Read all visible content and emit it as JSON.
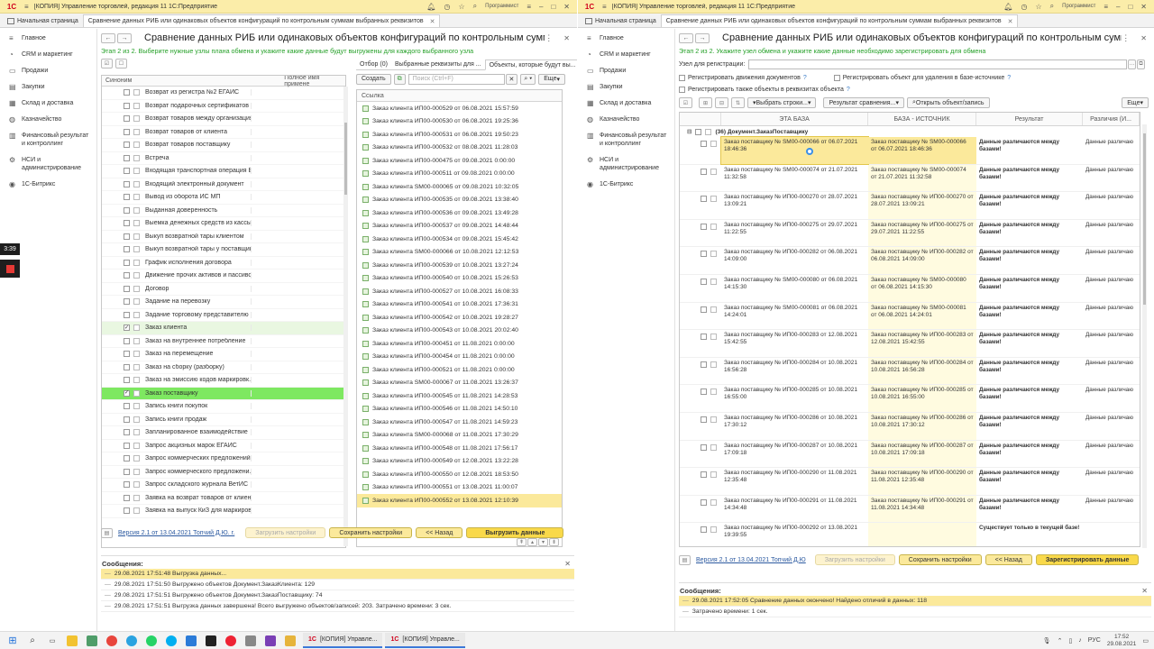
{
  "app": {
    "title": "[КОПИЯ] Управление торговлей, редакция 11  1С:Предприятие",
    "user": "Программист",
    "logo": "1С"
  },
  "tabs": {
    "home": "Начальная страница",
    "active": "Сравнение данных РИБ или одинаковых объектов конфигураций по контрольным суммам выбранных реквизитов"
  },
  "sidebar": [
    {
      "icon": "menu-icon",
      "label": "Главное"
    },
    {
      "icon": "crm-icon",
      "label": "CRM и маркетинг"
    },
    {
      "icon": "sales-icon",
      "label": "Продажи"
    },
    {
      "icon": "purchases-icon",
      "label": "Закупки"
    },
    {
      "icon": "warehouse-icon",
      "label": "Склад и доставка"
    },
    {
      "icon": "treasury-icon",
      "label": "Казначейство"
    },
    {
      "icon": "finance-icon",
      "label": "Финансовый результат и контроллинг"
    },
    {
      "icon": "nsi-icon",
      "label": "НСИ и администрирование"
    },
    {
      "icon": "bitrix-icon",
      "label": "1С-Битрикс"
    }
  ],
  "left": {
    "form_title": "Сравнение данных РИБ или одинаковых объектов конфигураций по контрольным суммам выбр...",
    "stage": "Этап 2 из 2. Выберите нужные узлы плана обмена и укажите какие данные будут выгружены для каждого выбранного узла",
    "col_synonym": "Синоним",
    "col_fullname": "Полное имя примене",
    "objects": [
      {
        "name": "Возврат из регистра №2 ЕГАИС",
        "checked": false,
        "state": ""
      },
      {
        "name": "Возврат подарочных сертификатов",
        "checked": false,
        "state": ""
      },
      {
        "name": "Возврат товаров между организациями",
        "checked": false,
        "state": ""
      },
      {
        "name": "Возврат товаров от клиента",
        "checked": false,
        "state": ""
      },
      {
        "name": "Возврат товаров поставщику",
        "checked": false,
        "state": ""
      },
      {
        "name": "Встреча",
        "checked": false,
        "state": ""
      },
      {
        "name": "Входящая транспортная операция В...",
        "checked": false,
        "state": ""
      },
      {
        "name": "Входящий электронный документ",
        "checked": false,
        "state": ""
      },
      {
        "name": "Вывод из оборота ИС МП",
        "checked": false,
        "state": ""
      },
      {
        "name": "Выданная доверенность",
        "checked": false,
        "state": ""
      },
      {
        "name": "Выемка денежных средств из кассы ...",
        "checked": false,
        "state": ""
      },
      {
        "name": "Выкуп возвратной тары клиентом",
        "checked": false,
        "state": ""
      },
      {
        "name": "Выкуп возвратной тары у поставщика",
        "checked": false,
        "state": ""
      },
      {
        "name": "График исполнения договора",
        "checked": false,
        "state": ""
      },
      {
        "name": "Движение прочих активов и пассивов",
        "checked": false,
        "state": ""
      },
      {
        "name": "Договор",
        "checked": false,
        "state": ""
      },
      {
        "name": "Задание на перевозку",
        "checked": false,
        "state": ""
      },
      {
        "name": "Задание торговому представителю",
        "checked": false,
        "state": ""
      },
      {
        "name": "Заказ клиента",
        "checked": true,
        "state": "sel"
      },
      {
        "name": "Заказ на внутреннее потребление",
        "checked": false,
        "state": ""
      },
      {
        "name": "Заказ на перемещение",
        "checked": false,
        "state": ""
      },
      {
        "name": "Заказ на сборку (разборку)",
        "checked": false,
        "state": ""
      },
      {
        "name": "Заказ на эмиссию кодов маркировк...",
        "checked": false,
        "state": ""
      },
      {
        "name": "Заказ поставщику",
        "checked": true,
        "state": "hl"
      },
      {
        "name": "Запись книги покупок",
        "checked": false,
        "state": ""
      },
      {
        "name": "Запись книги продаж",
        "checked": false,
        "state": ""
      },
      {
        "name": "Запланированное взаимодействие",
        "checked": false,
        "state": ""
      },
      {
        "name": "Запрос акцизных марок ЕГАИС",
        "checked": false,
        "state": ""
      },
      {
        "name": "Запрос коммерческих предложений ...",
        "checked": false,
        "state": ""
      },
      {
        "name": "Запрос коммерческого предложени...",
        "checked": false,
        "state": ""
      },
      {
        "name": "Запрос складского журнала ВетИС",
        "checked": false,
        "state": ""
      },
      {
        "name": "Заявка на возврат товаров от клиента",
        "checked": false,
        "state": ""
      },
      {
        "name": "Заявка на выпуск КиЗ для маркировки",
        "checked": false,
        "state": ""
      }
    ],
    "rp_tabs": [
      "Отбор (0)",
      "Выбранные реквизиты для ...",
      "Объекты, которые будут вы..."
    ],
    "create_btn": "Создать",
    "search_placeholder": "Поиск (Ctrl+F)",
    "more_btn": "Еще",
    "list_header": "Ссылка",
    "refs": [
      "Заказ клиента ИП00-000529 от 06.08.2021 15:57:59",
      "Заказ клиента ИП00-000530 от 06.08.2021 19:25:36",
      "Заказ клиента ИП00-000531 от 06.08.2021 19:50:23",
      "Заказ клиента ИП00-000532 от 08.08.2021 11:28:03",
      "Заказ клиента ИП00-000475 от 09.08.2021 0:00:00",
      "Заказ клиента ИП00-000511 от 09.08.2021 0:00:00",
      "Заказ клиента SM00-000065 от 09.08.2021 10:32:05",
      "Заказ клиента ИП00-000535 от 09.08.2021 13:38:40",
      "Заказ клиента ИП00-000536 от 09.08.2021 13:49:28",
      "Заказ клиента ИП00-000537 от 09.08.2021 14:48:44",
      "Заказ клиента ИП00-000534 от 09.08.2021 15:45:42",
      "Заказ клиента SM00-000066 от 10.08.2021 12:12:53",
      "Заказ клиента ИП00-000539 от 10.08.2021 13:27:24",
      "Заказ клиента ИП00-000540 от 10.08.2021 15:26:53",
      "Заказ клиента ИП00-000527 от 10.08.2021 16:08:33",
      "Заказ клиента ИП00-000541 от 10.08.2021 17:36:31",
      "Заказ клиента ИП00-000542 от 10.08.2021 19:28:27",
      "Заказ клиента ИП00-000543 от 10.08.2021 20:02:40",
      "Заказ клиента ИП00-000451 от 11.08.2021 0:00:00",
      "Заказ клиента ИП00-000454 от 11.08.2021 0:00:00",
      "Заказ клиента ИП00-000521 от 11.08.2021 0:00:00",
      "Заказ клиента SM00-000067 от 11.08.2021 13:26:37",
      "Заказ клиента ИП00-000545 от 11.08.2021 14:28:53",
      "Заказ клиента ИП00-000546 от 11.08.2021 14:50:10",
      "Заказ клиента ИП00-000547 от 11.08.2021 14:59:23",
      "Заказ клиента SM00-000068 от 11.08.2021 17:30:29",
      "Заказ клиента ИП00-000548 от 11.08.2021 17:56:17",
      "Заказ клиента ИП00-000549 от 12.08.2021 13:22:28",
      "Заказ клиента ИП00-000550 от 12.08.2021 18:53:50",
      "Заказ клиента ИП00-000551 от 13.08.2021 11:00:07",
      "Заказ клиента ИП00-000552 от 13.08.2021 12:10:39"
    ],
    "version_link": "Версия 2.1  от 13.04.2021 Топчий Д.Ю. г.",
    "load_settings": "Загрузить настройки",
    "save_settings": "Сохранить настройки",
    "back_btn": "<< Назад",
    "primary_btn": "Выгрузить данные",
    "messages_title": "Сообщения:",
    "messages": [
      "29.08.2021 17:51:48 Выгрузка данных...",
      "29.08.2021 17:51:50 Выгружено объектов Документ.ЗаказКлиента: 129",
      "29.08.2021 17:51:51 Выгружено объектов Документ.ЗаказПоставщику: 74",
      "29.08.2021 17:51:51 Выгрузка данных завершена! Всего выгружено объектов/записей: 203. Затрачено времени: 3 сек."
    ]
  },
  "right": {
    "form_title": "Сравнение данных РИБ или одинаковых объектов конфигураций по контрольным суммам выбр...",
    "stage": "Этап 2 из 2. Укажите узел обмена и укажите какие данные необходимо зарегистрировать для обмена",
    "node_label": "Узел для регистрации:",
    "chk_movements": "Регистрировать движения документов",
    "chk_delete": "Регистрировать объект для удаления в базе-источнике",
    "chk_attrs": "Регистрировать также объекты в реквизитах объекта",
    "select_rows": "Выбрать строки...",
    "compare_result": "Результат сравнения...",
    "open_object": "Открыть объект/запись",
    "more_btn": "Еще",
    "cols": [
      "ЭТА БАЗА",
      "БАЗА - ИСТОЧНИК",
      "Результат",
      "Различия (И..."
    ],
    "group": "(36) Документ.ЗаказПоставщику",
    "rows": [
      {
        "a": "Заказ поставщику № SM00-000066 от 06.07.2021 18:46:36",
        "b": "Заказ поставщику № SM00-000066 от 06.07.2021 18:46:36",
        "r": "Данные различаются между базами!",
        "d": "Данные различаю"
      },
      {
        "a": "Заказ поставщику № SM00-000074 от 21.07.2021 11:32:58",
        "b": "Заказ поставщику № SM00-000074 от 21.07.2021 11:32:58",
        "r": "Данные различаются между базами!",
        "d": "Данные различаю"
      },
      {
        "a": "Заказ поставщику № ИП00-000270 от 28.07.2021 13:09:21",
        "b": "Заказ поставщику № ИП00-000270 от 28.07.2021 13:09:21",
        "r": "Данные различаются между базами!",
        "d": "Данные различаю"
      },
      {
        "a": "Заказ поставщику № ИП00-000275 от 29.07.2021 11:22:55",
        "b": "Заказ поставщику № ИП00-000275 от 29.07.2021 11:22:55",
        "r": "Данные различаются между базами!",
        "d": "Данные различаю"
      },
      {
        "a": "Заказ поставщику № ИП00-000282 от 06.08.2021 14:09:00",
        "b": "Заказ поставщику № ИП00-000282 от 06.08.2021 14:09:00",
        "r": "Данные различаются между базами!",
        "d": "Данные различаю"
      },
      {
        "a": "Заказ поставщику № SM00-000080 от 06.08.2021 14:15:30",
        "b": "Заказ поставщику № SM00-000080 от 06.08.2021 14:15:30",
        "r": "Данные различаются между базами!",
        "d": "Данные различаю"
      },
      {
        "a": "Заказ поставщику № SM00-000081 от 06.08.2021 14:24:01",
        "b": "Заказ поставщику № SM00-000081 от 06.08.2021 14:24:01",
        "r": "Данные различаются между базами!",
        "d": "Данные различаю"
      },
      {
        "a": "Заказ поставщику № ИП00-000283 от 12.08.2021 15:42:55",
        "b": "Заказ поставщику № ИП00-000283 от 12.08.2021 15:42:55",
        "r": "Данные различаются между базами!",
        "d": "Данные различаю"
      },
      {
        "a": "Заказ поставщику № ИП00-000284 от 10.08.2021 16:56:28",
        "b": "Заказ поставщику № ИП00-000284 от 10.08.2021 16:56:28",
        "r": "Данные различаются между базами!",
        "d": "Данные различаю"
      },
      {
        "a": "Заказ поставщику № ИП00-000285 от 10.08.2021 16:55:00",
        "b": "Заказ поставщику № ИП00-000285 от 10.08.2021 16:55:00",
        "r": "Данные различаются между базами!",
        "d": "Данные различаю"
      },
      {
        "a": "Заказ поставщику № ИП00-000286 от 10.08.2021 17:30:12",
        "b": "Заказ поставщику № ИП00-000286 от 10.08.2021 17:30:12",
        "r": "Данные различаются между базами!",
        "d": "Данные различаю"
      },
      {
        "a": "Заказ поставщику № ИП00-000287 от 10.08.2021 17:09:18",
        "b": "Заказ поставщику № ИП00-000287 от 10.08.2021 17:09:18",
        "r": "Данные различаются между базами!",
        "d": "Данные различаю"
      },
      {
        "a": "Заказ поставщику № ИП00-000290 от 11.08.2021 12:35:48",
        "b": "Заказ поставщику № ИП00-000290 от 11.08.2021 12:35:48",
        "r": "Данные различаются между базами!",
        "d": "Данные различаю"
      },
      {
        "a": "Заказ поставщику № ИП00-000291 от 11.08.2021 14:34:48",
        "b": "Заказ поставщику № ИП00-000291 от 11.08.2021 14:34:48",
        "r": "Данные различаются между базами!",
        "d": "Данные различаю"
      },
      {
        "a": "Заказ поставщику № ИП00-000292 от 13.08.2021 19:39:55",
        "b": "",
        "r": "Существует только в текущей базе!",
        "d": ""
      }
    ],
    "version_link": "Версия 2.1  от 13.04.2021 Топчий Д.Ю",
    "load_settings": "Загрузить настройки",
    "save_settings": "Сохранить настройки",
    "back_btn": "<< Назад",
    "primary_btn": "Зарегистрировать данные",
    "messages_title": "Сообщения:",
    "messages": [
      "29.08.2021 17:52:05 Сравнение данных окончено! Найдено отличий в данных: 118",
      "Затрачено времени: 1 сек."
    ]
  },
  "recorder": {
    "time": "3:39"
  },
  "taskbar": {
    "app1": "[КОПИЯ] Управле...",
    "app2": "[КОПИЯ] Управле...",
    "lang": "РУС",
    "time": "17:52",
    "date": "29.08.2021"
  }
}
